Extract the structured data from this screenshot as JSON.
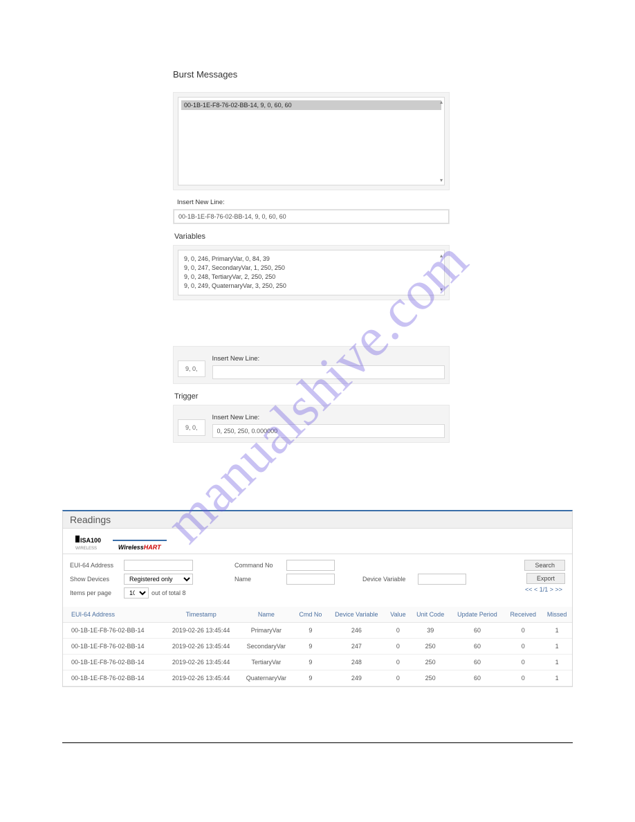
{
  "burst": {
    "title": "Burst Messages",
    "list_item": "00-1B-1E-F8-76-02-BB-14, 9, 0, 60, 60",
    "insert_label": "Insert New Line:",
    "insert_value": "00-1B-1E-F8-76-02-BB-14, 9, 0, 60, 60"
  },
  "variables": {
    "title": "Variables",
    "lines": [
      "9, 0, 246, PrimaryVar, 0, 84, 39",
      "9, 0, 247, SecondaryVar, 1, 250, 250",
      "9, 0, 248, TertiaryVar, 2, 250, 250",
      "9, 0, 249, QuaternaryVar, 3, 250, 250"
    ],
    "insert_label": "Insert New Line:",
    "prefix": "9, 0,"
  },
  "trigger": {
    "title": "Trigger",
    "insert_label": "Insert New Line:",
    "prefix": "9, 0,",
    "value": "0, 250, 250, 0.000000"
  },
  "readings": {
    "title": "Readings",
    "tab_isa": "ISA100",
    "tab_isa_sub": "WIRELESS",
    "tab_hart_a": "Wireless",
    "tab_hart_b": "HART",
    "eui_label": "EUI-64 Address",
    "cmd_label": "Command No",
    "show_label": "Show Devices",
    "show_value": "Registered only",
    "name_label": "Name",
    "devvar_label": "Device Variable",
    "items_label": "Items per page",
    "items_value": "10",
    "items_suffix": "out of total 8",
    "search_btn": "Search",
    "export_btn": "Export",
    "pager": "<< < 1/1 > >>",
    "cols": {
      "eui": "EUI-64 Address",
      "ts": "Timestamp",
      "name": "Name",
      "cmd": "Cmd No",
      "dv": "Device Variable",
      "val": "Value",
      "unit": "Unit Code",
      "upd": "Update Period",
      "recv": "Received",
      "miss": "Missed"
    },
    "rows": [
      {
        "eui": "00-1B-1E-F8-76-02-BB-14",
        "ts": "2019-02-26 13:45:44",
        "name": "PrimaryVar",
        "cmd": "9",
        "dv": "246",
        "val": "0",
        "unit": "39",
        "upd": "60",
        "recv": "0",
        "miss": "1"
      },
      {
        "eui": "00-1B-1E-F8-76-02-BB-14",
        "ts": "2019-02-26 13:45:44",
        "name": "SecondaryVar",
        "cmd": "9",
        "dv": "247",
        "val": "0",
        "unit": "250",
        "upd": "60",
        "recv": "0",
        "miss": "1"
      },
      {
        "eui": "00-1B-1E-F8-76-02-BB-14",
        "ts": "2019-02-26 13:45:44",
        "name": "TertiaryVar",
        "cmd": "9",
        "dv": "248",
        "val": "0",
        "unit": "250",
        "upd": "60",
        "recv": "0",
        "miss": "1"
      },
      {
        "eui": "00-1B-1E-F8-76-02-BB-14",
        "ts": "2019-02-26 13:45:44",
        "name": "QuaternaryVar",
        "cmd": "9",
        "dv": "249",
        "val": "0",
        "unit": "250",
        "upd": "60",
        "recv": "0",
        "miss": "1"
      }
    ]
  },
  "watermark": "manualshive.com"
}
